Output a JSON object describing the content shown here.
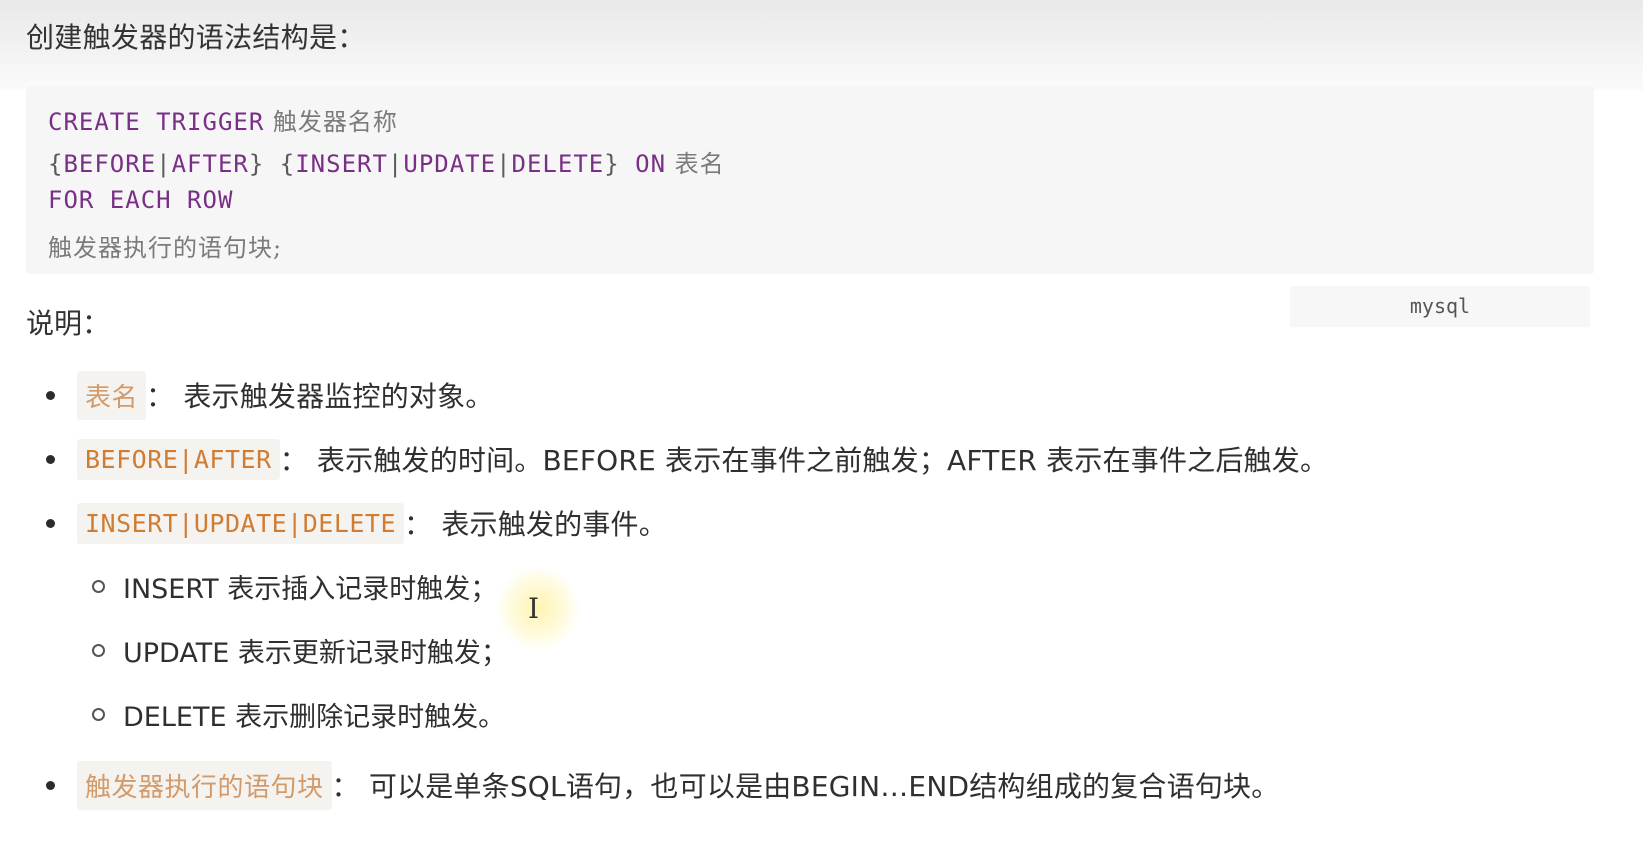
{
  "intro": "创建触发器的语法结构是：",
  "code": {
    "language_label": "mysql",
    "line1": {
      "kw": "CREATE TRIGGER",
      "text": " 触发器名称"
    },
    "line2": {
      "p1": "{",
      "k1": "BEFORE",
      "p2": "|",
      "k2": "AFTER",
      "p3": "} {",
      "k3": "INSERT",
      "p4": "|",
      "k4": "UPDATE",
      "p5": "|",
      "k5": "DELETE",
      "p6": "} ",
      "k6": "ON",
      "text": " 表名"
    },
    "line3": {
      "kw": "FOR EACH ROW"
    },
    "line4": {
      "text": "触发器执行的语句块;"
    }
  },
  "section_title": "说明：",
  "bullets": [
    {
      "code": "表名",
      "desc": "： 表示触发器监控的对象。"
    },
    {
      "code": "BEFORE|AFTER",
      "desc": "： 表示触发的时间。BEFORE 表示在事件之前触发；AFTER 表示在事件之后触发。"
    },
    {
      "code": "INSERT|UPDATE|DELETE",
      "desc": "： 表示触发的事件。"
    },
    {
      "code": "触发器执行的语句块",
      "desc": "： 可以是单条SQL语句，也可以是由BEGIN…END结构组成的复合语句块。"
    }
  ],
  "sub_bullets": [
    "INSERT 表示插入记录时触发；",
    "UPDATE 表示更新记录时触发；",
    "DELETE 表示删除记录时触发。"
  ],
  "cursor_glyph": "I"
}
